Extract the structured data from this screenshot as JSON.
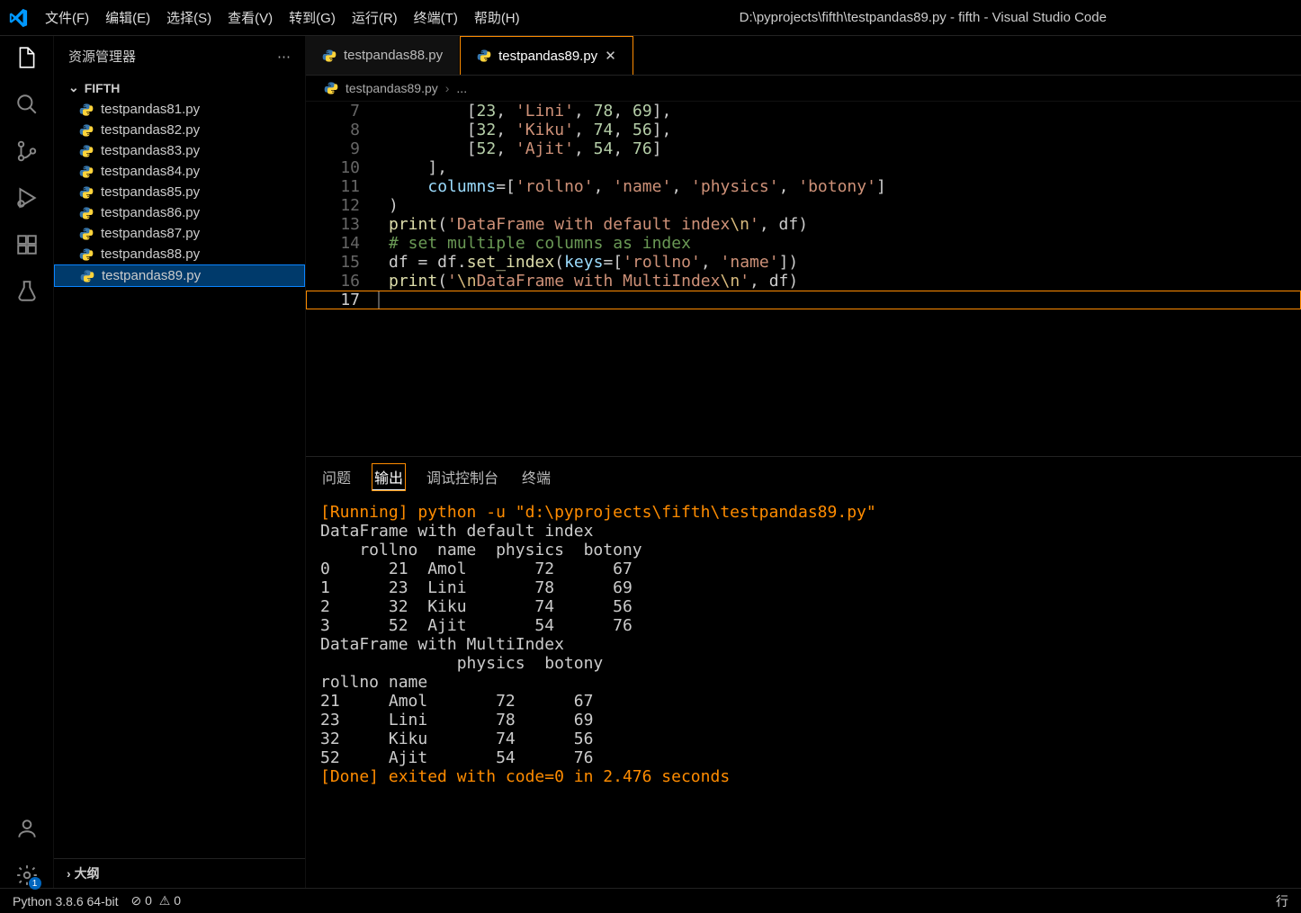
{
  "titlebar": {
    "menus": [
      "文件(F)",
      "编辑(E)",
      "选择(S)",
      "查看(V)",
      "转到(G)",
      "运行(R)",
      "终端(T)",
      "帮助(H)"
    ],
    "title": "D:\\pyprojects\\fifth\\testpandas89.py - fifth - Visual Studio Code"
  },
  "sidebar": {
    "title": "资源管理器",
    "section": "FIFTH",
    "files": [
      {
        "name": "testpandas81.py",
        "active": false
      },
      {
        "name": "testpandas82.py",
        "active": false
      },
      {
        "name": "testpandas83.py",
        "active": false
      },
      {
        "name": "testpandas84.py",
        "active": false
      },
      {
        "name": "testpandas85.py",
        "active": false
      },
      {
        "name": "testpandas86.py",
        "active": false
      },
      {
        "name": "testpandas87.py",
        "active": false
      },
      {
        "name": "testpandas88.py",
        "active": false
      },
      {
        "name": "testpandas89.py",
        "active": true
      }
    ],
    "outline": "大纲"
  },
  "tabs": [
    {
      "name": "testpandas88.py",
      "active": false
    },
    {
      "name": "testpandas89.py",
      "active": true
    }
  ],
  "breadcrumb": {
    "file": "testpandas89.py",
    "more": "..."
  },
  "code_lines": [
    {
      "n": "7",
      "html": "        [<span class='c-num'>23</span>, <span class='c-str'>'Lini'</span>, <span class='c-num'>78</span>, <span class='c-num'>69</span>],"
    },
    {
      "n": "8",
      "html": "        [<span class='c-num'>32</span>, <span class='c-str'>'Kiku'</span>, <span class='c-num'>74</span>, <span class='c-num'>56</span>],"
    },
    {
      "n": "9",
      "html": "        [<span class='c-num'>52</span>, <span class='c-str'>'Ajit'</span>, <span class='c-num'>54</span>, <span class='c-num'>76</span>]"
    },
    {
      "n": "10",
      "html": "    ],"
    },
    {
      "n": "11",
      "html": "    <span class='c-var'>columns</span>=[<span class='c-str'>'rollno'</span>, <span class='c-str'>'name'</span>, <span class='c-str'>'physics'</span>, <span class='c-str'>'botony'</span>]"
    },
    {
      "n": "12",
      "html": ")"
    },
    {
      "n": "13",
      "html": "<span class='c-fn'>print</span>(<span class='c-str'>'DataFrame with default index<span class='c-esc'>\\n</span>'</span>, df)"
    },
    {
      "n": "14",
      "html": "<span class='c-cmt'># set multiple columns as index</span>"
    },
    {
      "n": "15",
      "html": "df = df.<span class='c-fn'>set_index</span>(<span class='c-var'>keys</span>=[<span class='c-str'>'rollno'</span>, <span class='c-str'>'name'</span>])"
    },
    {
      "n": "16",
      "html": "<span class='c-fn'>print</span>(<span class='c-str'>'<span class='c-esc'>\\n</span>DataFrame with MultiIndex<span class='c-esc'>\\n</span>'</span>, df)"
    },
    {
      "n": "17",
      "html": "",
      "current": true
    }
  ],
  "panel": {
    "tabs": [
      "问题",
      "输出",
      "调试控制台",
      "终端"
    ],
    "active": 1,
    "output_lines": [
      {
        "text": "[Running] python -u \"d:\\pyprojects\\fifth\\testpandas89.py\"",
        "color": "#ff8c00"
      },
      {
        "text": "DataFrame with default index"
      },
      {
        "text": "    rollno  name  physics  botony"
      },
      {
        "text": "0      21  Amol       72      67"
      },
      {
        "text": "1      23  Lini       78      69"
      },
      {
        "text": "2      32  Kiku       74      56"
      },
      {
        "text": "3      52  Ajit       54      76"
      },
      {
        "text": ""
      },
      {
        "text": "DataFrame with MultiIndex"
      },
      {
        "text": "              physics  botony"
      },
      {
        "text": "rollno name                  "
      },
      {
        "text": "21     Amol       72      67"
      },
      {
        "text": "23     Lini       78      69"
      },
      {
        "text": "32     Kiku       74      56"
      },
      {
        "text": "52     Ajit       54      76"
      },
      {
        "text": ""
      },
      {
        "text": "[Done] exited with code=0 in 2.476 seconds",
        "color": "#ff8c00"
      }
    ]
  },
  "status": {
    "python": "Python 3.8.6 64-bit",
    "errors": "0",
    "warnings": "0",
    "line_label": "行"
  }
}
